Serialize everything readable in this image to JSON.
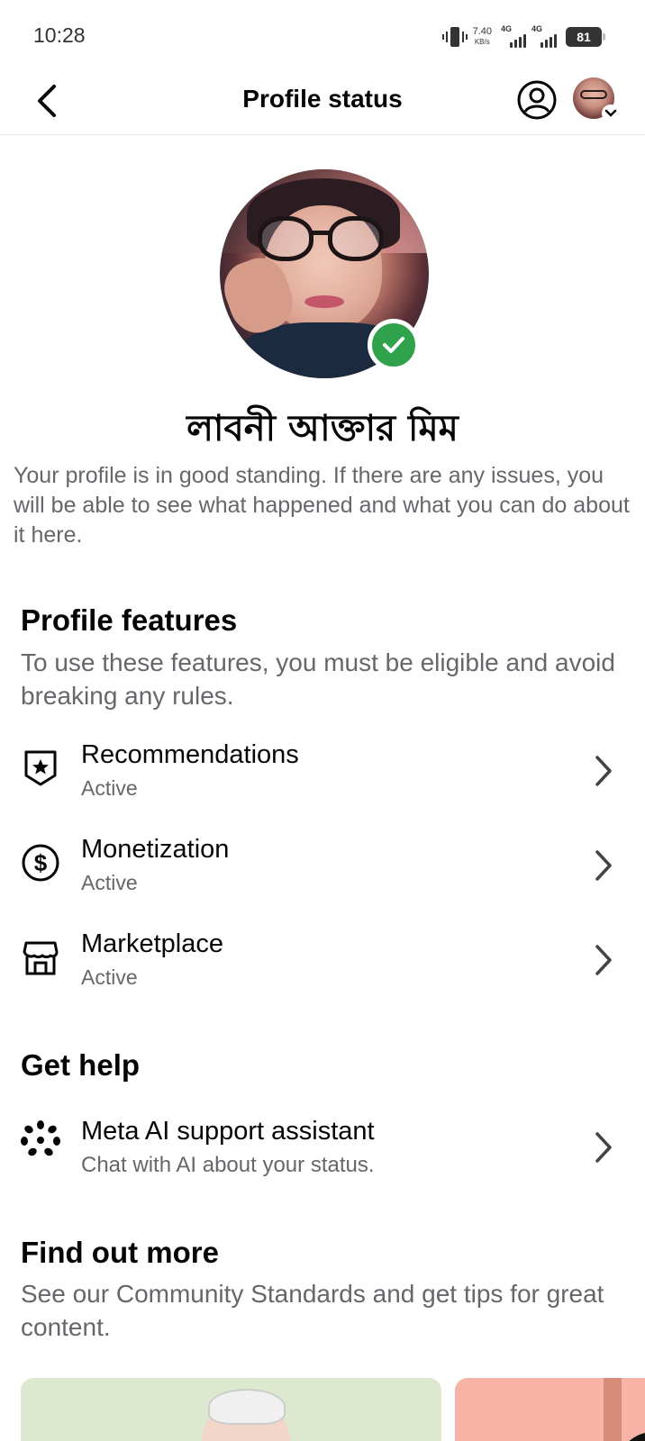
{
  "status_bar": {
    "time": "10:28",
    "net_speed_value": "7.40",
    "net_speed_unit": "KB/s",
    "sim1_label": "4G",
    "sim2_label": "4G",
    "battery": "81"
  },
  "header": {
    "title": "Profile status"
  },
  "profile": {
    "name": "লাবনী আক্তার মিম",
    "standing_text": "Your profile is in good standing. If there are any issues, you will be able to see what happened and what you can do about it here."
  },
  "profile_features": {
    "title": "Profile features",
    "description": "To use these features, you must be eligible and avoid breaking any rules.",
    "items": [
      {
        "label": "Recommendations",
        "status": "Active",
        "icon": "shield-star-icon"
      },
      {
        "label": "Monetization",
        "status": "Active",
        "icon": "dollar-circle-icon"
      },
      {
        "label": "Marketplace",
        "status": "Active",
        "icon": "storefront-icon"
      }
    ]
  },
  "get_help": {
    "title": "Get help",
    "items": [
      {
        "label": "Meta AI support assistant",
        "subtitle": "Chat with AI about your status.",
        "icon": "meta-ai-dots-icon"
      }
    ]
  },
  "find_out_more": {
    "title": "Find out more",
    "description": "See our Community Standards and get tips for great content."
  },
  "colors": {
    "verified_green": "#31a24c",
    "secondary_text": "#65676b",
    "primary_text": "#050505",
    "divider": "#e4e6eb"
  }
}
